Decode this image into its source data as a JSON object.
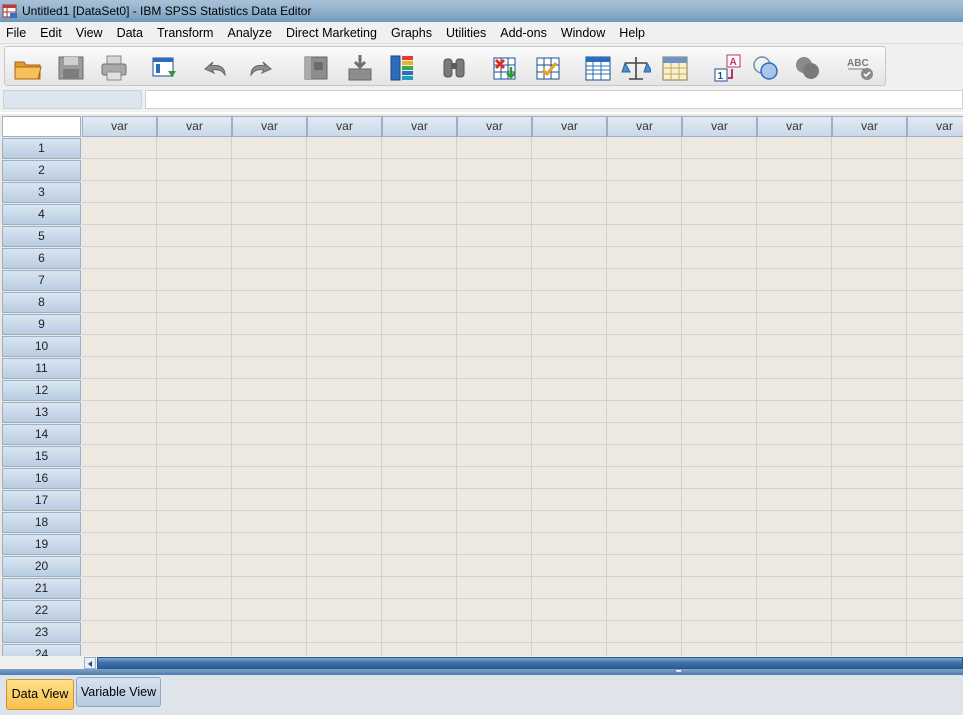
{
  "window": {
    "title": "Untitled1 [DataSet0] - IBM SPSS Statistics Data Editor",
    "icon": "spss-app-icon"
  },
  "menu": [
    "File",
    "Edit",
    "View",
    "Data",
    "Transform",
    "Analyze",
    "Direct Marketing",
    "Graphs",
    "Utilities",
    "Add-ons",
    "Window",
    "Help"
  ],
  "toolbar": {
    "icons": [
      "open-folder-icon",
      "save-icon",
      "print-icon",
      "dialog-recall-icon",
      "undo-icon",
      "redo-icon",
      "goto-case-icon",
      "goto-variable-icon",
      "variables-icon",
      "find-icon",
      "insert-cases-icon",
      "insert-variable-icon",
      "split-file-icon",
      "weight-cases-icon",
      "select-cases-icon",
      "value-labels-icon",
      "use-variable-sets-icon",
      "show-all-variables-icon",
      "spell-check-icon"
    ]
  },
  "editor": {
    "cell_reference": "",
    "cell_value": ""
  },
  "grid": {
    "column_headers": [
      "var",
      "var",
      "var",
      "var",
      "var",
      "var",
      "var",
      "var",
      "var",
      "var",
      "var",
      "var"
    ],
    "row_headers": [
      "1",
      "2",
      "3",
      "4",
      "5",
      "6",
      "7",
      "8",
      "9",
      "10",
      "11",
      "12",
      "13",
      "14",
      "15",
      "16",
      "17",
      "18",
      "19",
      "20",
      "21",
      "22",
      "23",
      "24"
    ]
  },
  "tabs": {
    "data_view": "Data View",
    "variable_view": "Variable View",
    "active": "data_view"
  },
  "colors": {
    "title_bar": "#8fb0cb",
    "grid_background": "#ede9e1",
    "header_blue": "#c9d8e8",
    "active_tab": "#f6c14e",
    "scrollbar": "#3e6fa8"
  }
}
